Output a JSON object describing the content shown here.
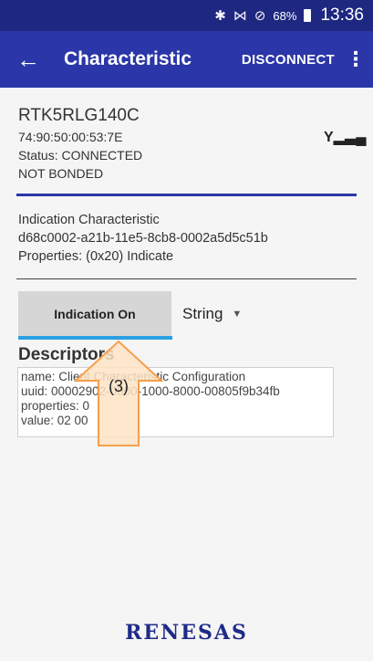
{
  "status_bar": {
    "icons": [
      "bluetooth-icon",
      "vibrate-icon",
      "do-not-disturb-icon"
    ],
    "battery": "68%",
    "time": "13:36"
  },
  "app_bar": {
    "back_glyph": "←",
    "title": "Characteristic",
    "disconnect_label": "DISCONNECT",
    "more_glyph": "⋮"
  },
  "device": {
    "name": "RTK5RLG140C",
    "address": "74:90:50:00:53:7E",
    "status": "Status: CONNECTED",
    "bond": "NOT BONDED",
    "signal_glyph": "Y▂▃▄"
  },
  "characteristic": {
    "name": "Indication Characteristic",
    "uuid": "d68c0002-a21b-11e5-8cb8-0002a5d5c51b",
    "properties": "Properties: (0x20) Indicate"
  },
  "controls": {
    "indication_button": "Indication On",
    "type_value": "String"
  },
  "descriptors": {
    "title": "Descriptors",
    "lines": [
      "name: Client Characteristic Configuration",
      "uuid: 00002902-0000-1000-8000-00805f9b34fb",
      "properties: 0",
      "value: 02 00"
    ]
  },
  "callout": {
    "label": "(3)",
    "color": "#f5a04a",
    "fill": "#fde3c4"
  },
  "brand": {
    "logo": "RENESAS",
    "accent": "#2b36a8",
    "status_bar": "#1e2880"
  }
}
